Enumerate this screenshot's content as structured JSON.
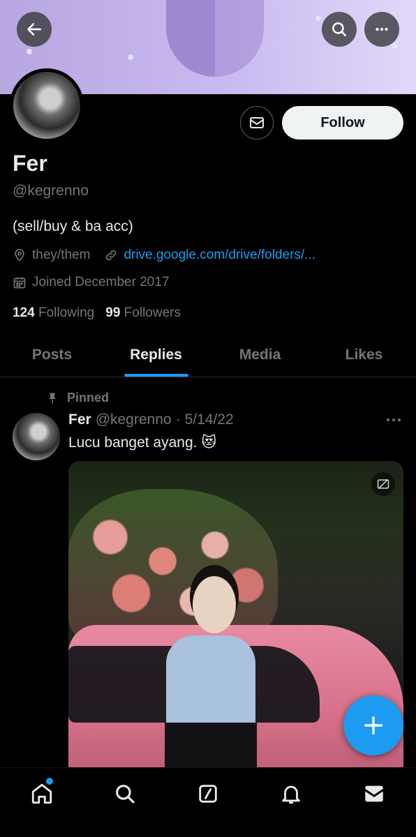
{
  "profile": {
    "name": "Fer",
    "handle": "@kegrenno",
    "bio": "(sell/buy & ba acc)",
    "pronouns": "they/them",
    "link": "drive.google.com/drive/folders/...",
    "joined": "Joined December 2017",
    "following_count": "124",
    "following_label": "Following",
    "followers_count": "99",
    "followers_label": "Followers"
  },
  "actions": {
    "follow_label": "Follow"
  },
  "tabs": [
    {
      "label": "Posts",
      "active": false
    },
    {
      "label": "Replies",
      "active": true
    },
    {
      "label": "Media",
      "active": false
    },
    {
      "label": "Likes",
      "active": false
    }
  ],
  "pinned_tweet": {
    "pinned_label": "Pinned",
    "author_name": "Fer",
    "author_handle": "@kegrenno",
    "separator": "·",
    "date": "5/14/22",
    "text": "Lucu banget ayang. 😻"
  },
  "icons": {
    "back": "arrow-left-icon",
    "search": "search-icon",
    "more": "more-horizontal-icon",
    "message": "envelope-icon",
    "location": "location-pin-icon",
    "link": "link-icon",
    "calendar": "calendar-icon",
    "pin": "pin-icon",
    "gif": "gif-badge-icon",
    "compose": "plus-icon"
  },
  "bottom_nav": [
    {
      "name": "home-icon",
      "has_notification_dot": true
    },
    {
      "name": "search-icon"
    },
    {
      "name": "grok-icon"
    },
    {
      "name": "bell-icon"
    },
    {
      "name": "mail-icon"
    }
  ],
  "colors": {
    "accent": "#1d9bf0",
    "background": "#000000",
    "text_primary": "#e7e9ea",
    "text_secondary": "#71767b",
    "banner": "#c9baf0"
  }
}
